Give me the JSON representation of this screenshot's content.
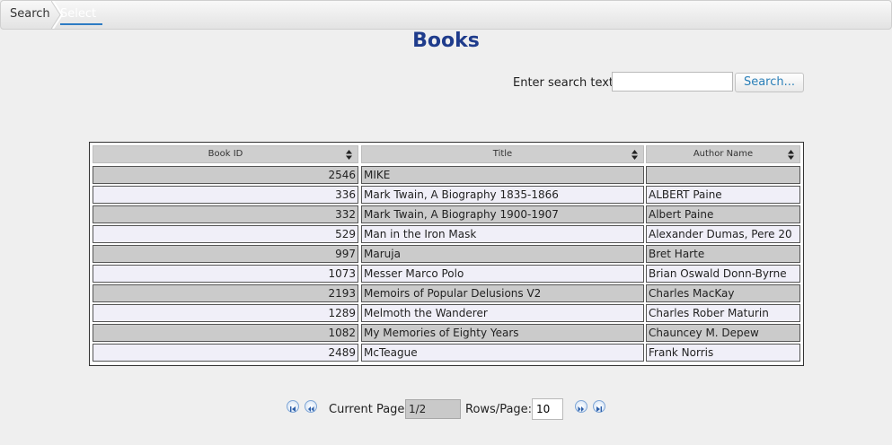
{
  "breadcrumb": {
    "items": [
      "Search",
      "Select"
    ]
  },
  "page": {
    "title": "Books"
  },
  "search": {
    "label": "Enter search text:",
    "value": "",
    "button": "Search..."
  },
  "table": {
    "columns": [
      "Book ID",
      "Title",
      "Author Name"
    ],
    "rows": [
      [
        "2546",
        "MIKE",
        ""
      ],
      [
        "336",
        "Mark Twain, A Biography 1835-1866",
        "ALBERT Paine"
      ],
      [
        "332",
        "Mark Twain, A Biography 1900-1907",
        "Albert Paine"
      ],
      [
        "529",
        "Man in the Iron Mask",
        "Alexander Dumas, Pere 20"
      ],
      [
        "997",
        "Maruja",
        "Bret Harte"
      ],
      [
        "1073",
        "Messer Marco Polo",
        "Brian Oswald Donn-Byrne"
      ],
      [
        "2193",
        "Memoirs of Popular Delusions V2",
        "Charles MacKay"
      ],
      [
        "1289",
        "Melmoth the Wanderer",
        "Charles Rober Maturin"
      ],
      [
        "1082",
        "My Memories of Eighty Years",
        "Chauncey M. Depew"
      ],
      [
        "2489",
        "McTeague",
        "Frank Norris"
      ]
    ]
  },
  "pager": {
    "current_label": "Current Page:",
    "current_value": "1/2",
    "rows_label": "Rows/Page:",
    "rows_value": "10"
  },
  "colors": {
    "title": "#1f3c8c",
    "link": "#2a7fb8",
    "row_odd": "#cbcbcb",
    "row_even": "#f0eff8"
  }
}
